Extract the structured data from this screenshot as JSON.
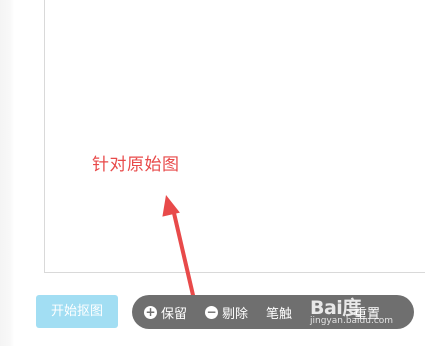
{
  "canvas": {
    "annotation": "针对原始图"
  },
  "actions": {
    "start_label": "开始抠图"
  },
  "toolbar": {
    "keep": {
      "icon": "plus-circle-icon",
      "label": "保留"
    },
    "remove": {
      "icon": "minus-circle-icon",
      "label": "剔除"
    },
    "brush": {
      "label": "笔触"
    },
    "reset": {
      "label": "重置"
    }
  },
  "watermark": {
    "logo": "Bai度",
    "url": "jingyan.baidu.com"
  },
  "colors": {
    "accent": "#a2def3",
    "toolbar_bg": "#6f6f6f",
    "annotation": "#e84a4a"
  }
}
